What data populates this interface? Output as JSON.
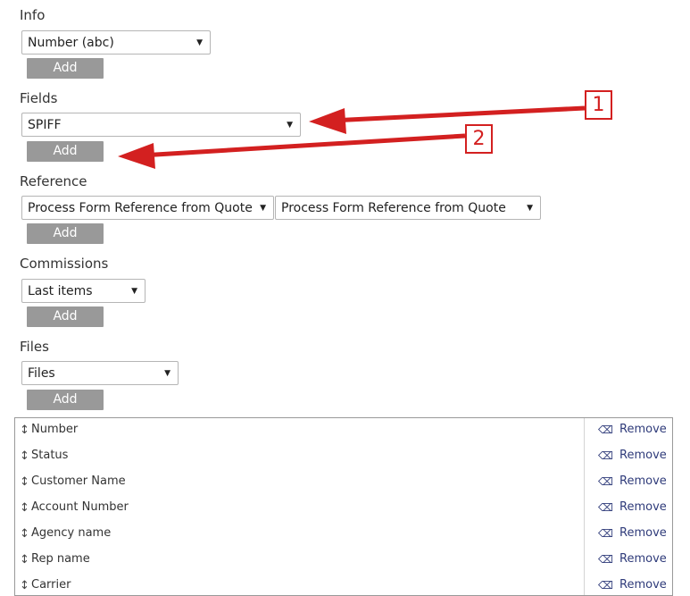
{
  "sections": [
    {
      "label": "Info",
      "select_value": "Number (abc)",
      "add_label": "Add"
    },
    {
      "label": "Fields",
      "select_value": "SPIFF",
      "add_label": "Add"
    },
    {
      "label": "Reference",
      "select_value": "Process Form Reference from Quote",
      "select2_value": "Process Form Reference from Quote",
      "add_label": "Add"
    },
    {
      "label": "Commissions",
      "select_value": "Last items",
      "add_label": "Add"
    },
    {
      "label": "Files",
      "select_value": "Files",
      "add_label": "Add"
    }
  ],
  "list": {
    "remove_label": "Remove",
    "items": [
      "Number",
      "Status",
      "Customer Name",
      "Account Number",
      "Agency name",
      "Rep name",
      "Carrier"
    ]
  },
  "annotations": {
    "callout1": "1",
    "callout2": "2"
  },
  "colors": {
    "arrow": "#d32020",
    "button": "#999999",
    "remove_link": "#2f3b7a"
  }
}
